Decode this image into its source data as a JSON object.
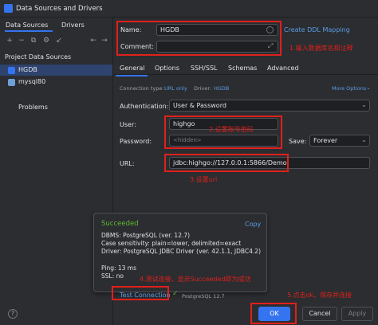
{
  "window": {
    "title": "Data Sources and Drivers"
  },
  "left_panel": {
    "tabs": [
      "Data Sources",
      "Drivers"
    ],
    "toolbar": [
      "+",
      "−",
      "⧉",
      "⚙",
      "↙",
      "←",
      "→"
    ],
    "section_label": "Project Data Sources",
    "items": [
      {
        "label": "HGDB",
        "selected": true,
        "icon_color": "#3574f0"
      },
      {
        "label": "mysql80",
        "selected": false,
        "icon_color": "#6fa0d8"
      }
    ],
    "problems_label": "Problems"
  },
  "form": {
    "name_label": "Name:",
    "name_value": "HGDB",
    "comment_label": "Comment:",
    "comment_value": "",
    "create_ddl_link": "Create DDL Mapping",
    "tabs": [
      "General",
      "Options",
      "SSH/SSL",
      "Schemas",
      "Advanced"
    ],
    "active_tab": "General",
    "connection_type_label": "Connection type:",
    "connection_type_value": "URL only",
    "driver_label": "Driver:",
    "driver_value": "HGDB",
    "more_options": "More Options",
    "authentication_label": "Authentication:",
    "authentication_value": "User & Password",
    "user_label": "User:",
    "user_value": "highgo",
    "password_label": "Password:",
    "password_value": "<hidden>",
    "save_label": "Save:",
    "save_value": "Forever",
    "url_label": "URL:",
    "url_value": "jdbc:highgo://127.0.0.1:5866/Demo"
  },
  "annotations": {
    "a1": "1.输入数据库名和注释",
    "a2": "2.设置账号密码",
    "a3": "3.设置url",
    "a4": "4.测试连接，显示Succeeded即为成功",
    "a5": "5.点击ok，保存并连接"
  },
  "popup": {
    "status": "Succeeded",
    "copy": "Copy",
    "line1": "DBMS: PostgreSQL (ver. 12.7)",
    "line2": "Case sensitivity: plain=lower, delimited=exact",
    "line3": "Driver: PostgreSQL JDBC Driver (ver. 42.1.1, JDBC4.2)",
    "line4": "Ping: 13 ms",
    "line5": "SSL: no"
  },
  "bottom": {
    "test_connection": "Test Connection",
    "test_result": "PostgreSQL 12.7",
    "ok": "OK",
    "cancel": "Cancel",
    "apply": "Apply",
    "help": "?"
  },
  "colors": {
    "accent": "#3574f0",
    "annotation": "#e0201c",
    "success": "#5fb832"
  }
}
